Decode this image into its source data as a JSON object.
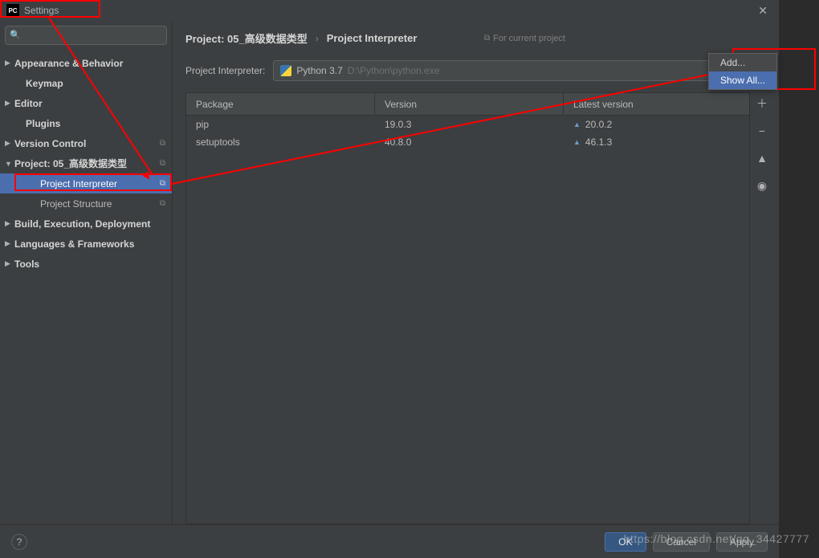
{
  "window": {
    "title": "Settings",
    "logo": "PC"
  },
  "search": {
    "placeholder": ""
  },
  "sidebar": {
    "items": [
      {
        "label": "Appearance & Behavior",
        "arrow": "▶",
        "bold": true
      },
      {
        "label": "Keymap",
        "bold": true,
        "indent": 1
      },
      {
        "label": "Editor",
        "arrow": "▶",
        "bold": true
      },
      {
        "label": "Plugins",
        "bold": true,
        "indent": 1
      },
      {
        "label": "Version Control",
        "arrow": "▶",
        "bold": true,
        "copy": true
      },
      {
        "label": "Project: 05_高级数据类型",
        "arrow": "▼",
        "bold": true,
        "copy": true
      },
      {
        "label": "Project Interpreter",
        "indent": 2,
        "copy": true,
        "selected": true
      },
      {
        "label": "Project Structure",
        "indent": 2,
        "copy": true
      },
      {
        "label": "Build, Execution, Deployment",
        "arrow": "▶",
        "bold": true
      },
      {
        "label": "Languages & Frameworks",
        "arrow": "▶",
        "bold": true
      },
      {
        "label": "Tools",
        "arrow": "▶",
        "bold": true
      }
    ]
  },
  "breadcrumb": {
    "crumb1": "Project: 05_高级数据类型",
    "sep": "›",
    "crumb2": "Project Interpreter",
    "badge": "For current project"
  },
  "interpreter": {
    "label": "Project Interpreter:",
    "name": "Python 3.7",
    "path": "D:\\Python\\python.exe"
  },
  "table": {
    "headers": {
      "c1": "Package",
      "c2": "Version",
      "c3": "Latest version"
    },
    "rows": [
      {
        "pkg": "pip",
        "ver": "19.0.3",
        "latest": "20.0.2"
      },
      {
        "pkg": "setuptools",
        "ver": "40.8.0",
        "latest": "46.1.3"
      }
    ]
  },
  "dropdown": {
    "add": "Add...",
    "showall": "Show All..."
  },
  "footer": {
    "ok": "OK",
    "cancel": "Cancel",
    "apply": "Apply"
  },
  "watermark": "https://blog.csdn.net/qq_34427777"
}
